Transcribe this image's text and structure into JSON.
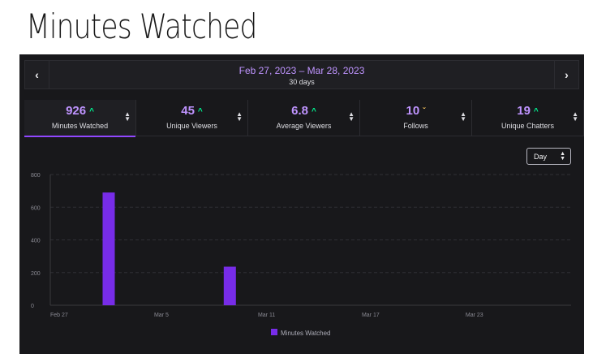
{
  "page_title": "Minutes Watched",
  "date_bar": {
    "prev_icon": "chevron-left-icon",
    "next_icon": "chevron-right-icon",
    "range": "Feb 27, 2023 – Mar 28, 2023",
    "days": "30 days"
  },
  "stats": [
    {
      "value": "926",
      "trend": "up",
      "label": "Minutes Watched",
      "active": true
    },
    {
      "value": "45",
      "trend": "up",
      "label": "Unique Viewers",
      "active": false
    },
    {
      "value": "6.8",
      "trend": "up",
      "label": "Average Viewers",
      "active": false
    },
    {
      "value": "10",
      "trend": "down",
      "label": "Follows",
      "active": false
    },
    {
      "value": "19",
      "trend": "up",
      "label": "Unique Chatters",
      "active": false
    }
  ],
  "granularity_select": {
    "value": "Day"
  },
  "colors": {
    "accent": "#9147ff",
    "bar": "#772ce8",
    "value_text": "#bf94ff",
    "trend_up": "#00f593",
    "trend_down": "#ffca5f"
  },
  "chart_data": {
    "type": "bar",
    "x_ticks": [
      "Feb 27",
      "Mar 5",
      "Mar 11",
      "Mar 17",
      "Mar 23"
    ],
    "y_ticks": [
      "0",
      "200",
      "400",
      "600",
      "800"
    ],
    "ylim": [
      0,
      800
    ],
    "series": [
      {
        "name": "Minutes Watched",
        "values": [
          {
            "x": "Mar 2",
            "y": 690
          },
          {
            "x": "Mar 9",
            "y": 236
          }
        ]
      }
    ],
    "legend_position": "bottom-center",
    "grid": true
  }
}
